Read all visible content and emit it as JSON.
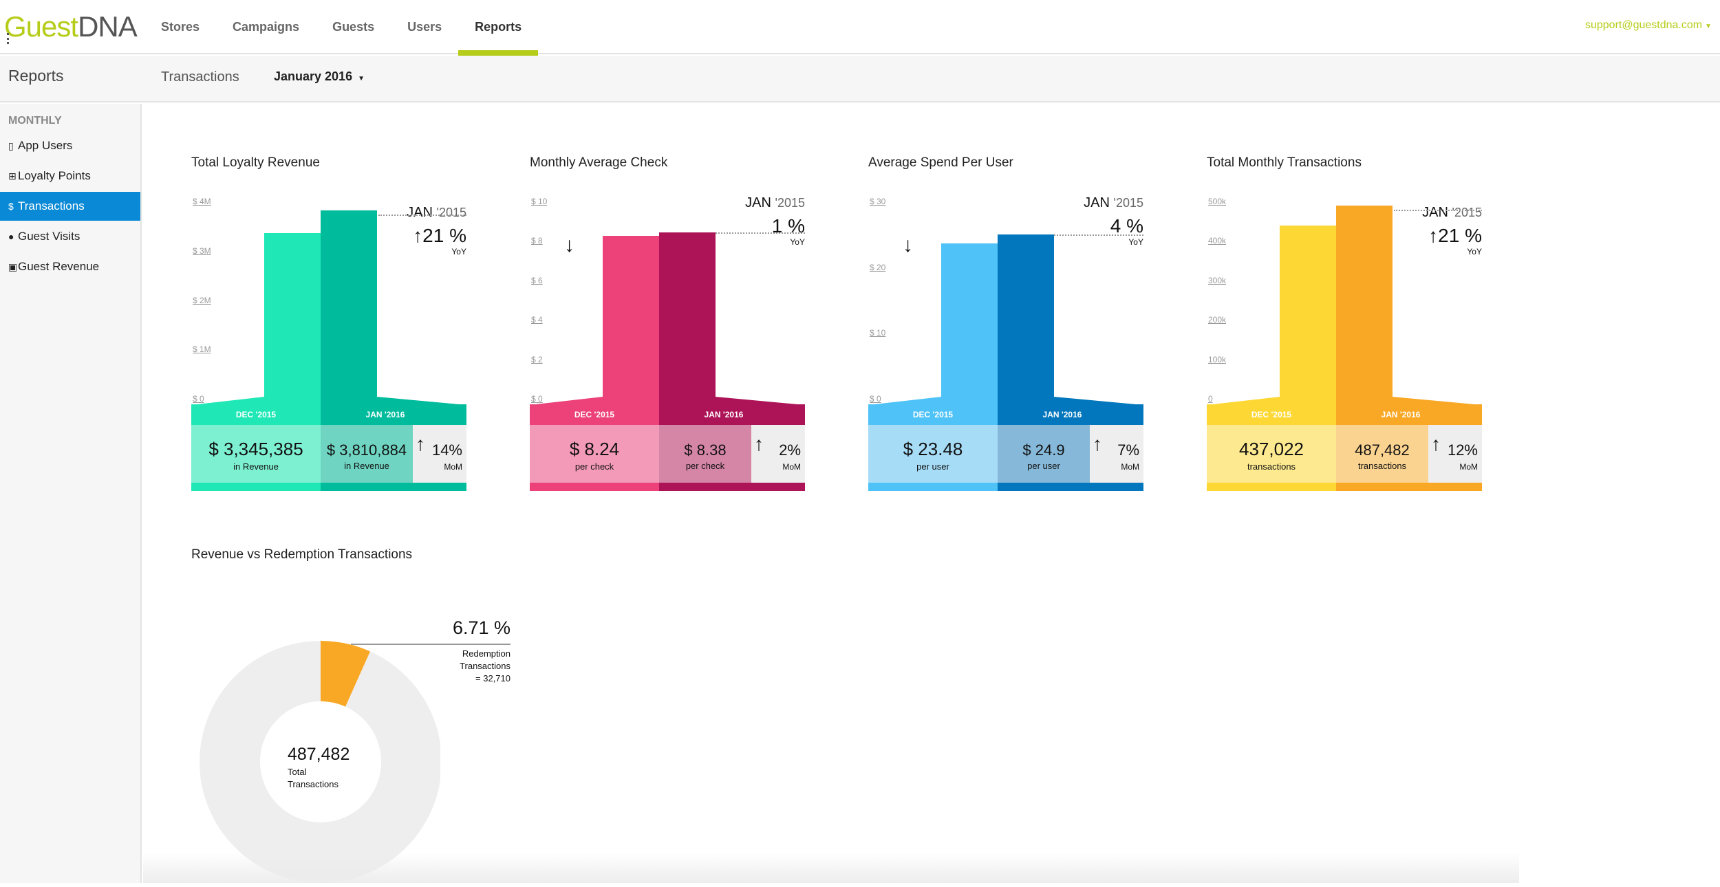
{
  "app": {
    "logo_g": "Guest",
    "logo_dna": "DNA",
    "nav": [
      "Stores",
      "Campaigns",
      "Guests",
      "Users",
      "Reports"
    ],
    "active_nav": "Reports",
    "user_email": "support@guestdna.com",
    "accent": "#b5cc18"
  },
  "subheader": {
    "title": "Reports",
    "section": "Transactions",
    "month": "January 2016"
  },
  "sidebar": {
    "heading": "MONTHLY",
    "items": [
      {
        "label": "App Users",
        "icon": "mobile-icon"
      },
      {
        "label": "Loyalty Points",
        "icon": "grid-icon"
      },
      {
        "label": "Transactions",
        "icon": "dollar-icon",
        "active": true
      },
      {
        "label": "Guest Visits",
        "icon": "person-icon"
      },
      {
        "label": "Guest Revenue",
        "icon": "cash-icon"
      }
    ],
    "active_color": "#0a8ad6"
  },
  "cards": [
    {
      "title": "Total Loyalty Revenue",
      "y_ticks": [
        "$ 4M",
        "$ 3M",
        "$ 2M",
        "$ 1M",
        "$ 0"
      ],
      "prev_label": "DEC '2015",
      "cur_label": "JAN '2016",
      "prev_value": "$ 3,345,385",
      "cur_value": "$ 3,810,884",
      "unit": "in Revenue",
      "mom": "14%",
      "mom_label": "MoM",
      "mom_dir": "up",
      "yoy_month": "JAN",
      "yoy_year": "'2015",
      "yoy": "21 %",
      "yoy_label": "YoY",
      "yoy_dir": "up",
      "colors": {
        "light": "#1fe8b6",
        "dark": "#00bc9c",
        "box_light": "#7ef0d2",
        "box_dark": "#6fd5c2",
        "band": "#00cba8"
      },
      "chart_data": {
        "type": "bar",
        "categories": [
          "DEC '2015",
          "JAN '2016"
        ],
        "values": [
          3345385,
          3810884
        ],
        "ylim": [
          0,
          4000000
        ]
      }
    },
    {
      "title": "Monthly Average Check",
      "y_ticks": [
        "$ 10",
        "$ 8",
        "$ 6",
        "$ 4",
        "$ 2",
        "$ 0"
      ],
      "prev_label": "DEC '2015",
      "cur_label": "JAN '2016",
      "prev_value": "$ 8.24",
      "cur_value": "$ 8.38",
      "unit": "per check",
      "mom": "2%",
      "mom_label": "MoM",
      "mom_dir": "up",
      "yoy_month": "JAN",
      "yoy_year": "'2015",
      "yoy": "1 %",
      "yoy_label": "YoY",
      "yoy_dir": "down",
      "colors": {
        "light": "#ec4179",
        "dark": "#ad1457",
        "box_light": "#f39ab9",
        "box_dark": "#d585a6",
        "band": "#c2185b"
      },
      "chart_data": {
        "type": "bar",
        "categories": [
          "DEC '2015",
          "JAN '2016"
        ],
        "values": [
          8.24,
          8.38
        ],
        "ylim": [
          0,
          10
        ]
      }
    },
    {
      "title": "Average Spend Per User",
      "y_ticks": [
        "$ 30",
        "$ 20",
        "$ 10",
        "$ 0"
      ],
      "prev_label": "DEC '2015",
      "cur_label": "JAN '2016",
      "prev_value": "$ 23.48",
      "cur_value": "$ 24.9",
      "unit": "per user",
      "mom": "7%",
      "mom_label": "MoM",
      "mom_dir": "up",
      "yoy_month": "JAN",
      "yoy_year": "'2015",
      "yoy": "4 %",
      "yoy_label": "YoY",
      "yoy_dir": "down",
      "colors": {
        "light": "#4fc3f7",
        "dark": "#0277bd",
        "box_light": "#a7dcf7",
        "box_dark": "#86b9d9",
        "band": "#0288d1"
      },
      "chart_data": {
        "type": "bar",
        "categories": [
          "DEC '2015",
          "JAN '2016"
        ],
        "values": [
          23.48,
          24.9
        ],
        "ylim": [
          0,
          30
        ]
      }
    },
    {
      "title": "Total Monthly Transactions",
      "y_ticks": [
        "500k",
        "400k",
        "300k",
        "200k",
        "100k",
        "0"
      ],
      "prev_label": "DEC '2015",
      "cur_label": "JAN '2016",
      "prev_value": "437,022",
      "cur_value": "487,482",
      "unit": "transactions",
      "mom": "12%",
      "mom_label": "MoM",
      "mom_dir": "up",
      "yoy_month": "JAN",
      "yoy_year": "'2015",
      "yoy": "21 %",
      "yoy_label": "YoY",
      "yoy_dir": "up",
      "colors": {
        "light": "#fdd835",
        "dark": "#f9a825",
        "box_light": "#fde98f",
        "box_dark": "#fbd390",
        "band": "#f9b025"
      },
      "chart_data": {
        "type": "bar",
        "categories": [
          "DEC '2015",
          "JAN '2016"
        ],
        "values": [
          437022,
          487482
        ],
        "ylim": [
          0,
          500000
        ]
      }
    }
  ],
  "redemption": {
    "title": "Revenue vs Redemption Transactions",
    "total": "487,482",
    "total_label_1": "Total",
    "total_label_2": "Transactions",
    "pct": "6.71 %",
    "red_label_1": "Redemption",
    "red_label_2": "Transactions",
    "red_label_3": "= 32,710",
    "colors": {
      "slice": "#f9a825",
      "rest": "#eeeeee"
    },
    "chart_data": {
      "type": "pie",
      "categories": [
        "Redemption Transactions",
        "Other"
      ],
      "values": [
        32710,
        454772
      ]
    }
  }
}
